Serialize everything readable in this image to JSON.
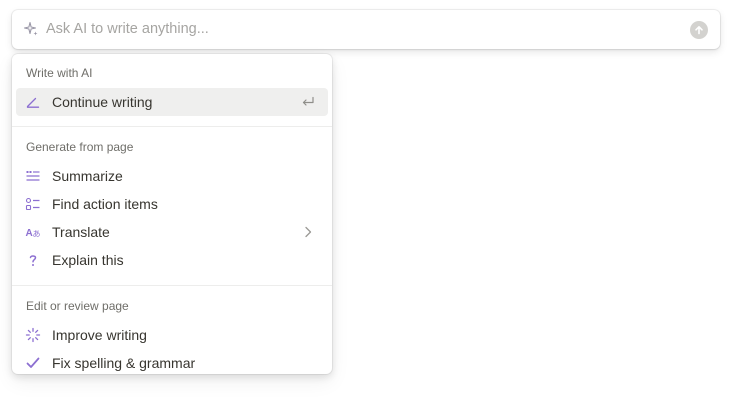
{
  "ask": {
    "placeholder": "Ask AI to write anything...",
    "icon": "sparkle-icon",
    "submit_icon": "arrow-up-circle-icon"
  },
  "menu": {
    "sections": [
      {
        "label": "Write with AI",
        "items": [
          {
            "label": "Continue writing",
            "icon": "pen-line-icon",
            "trailing": "enter-return-icon"
          }
        ]
      },
      {
        "label": "Generate from page",
        "items": [
          {
            "label": "Summarize",
            "icon": "summary-lines-icon"
          },
          {
            "label": "Find action items",
            "icon": "checklist-icon"
          },
          {
            "label": "Translate",
            "icon": "translate-icon",
            "trailing": "chevron-right-icon"
          },
          {
            "label": "Explain this",
            "icon": "question-mark-icon"
          }
        ]
      },
      {
        "label": "Edit or review page",
        "items": [
          {
            "label": "Improve writing",
            "icon": "loading-sparkle-icon"
          },
          {
            "label": "Fix spelling & grammar",
            "icon": "checkmark-icon"
          }
        ]
      }
    ]
  },
  "colors": {
    "accent_purple": "#8c6fd1",
    "text": "#37352f",
    "muted": "#6f6e69",
    "placeholder": "#a6a5a2",
    "hover": "#efefee"
  }
}
